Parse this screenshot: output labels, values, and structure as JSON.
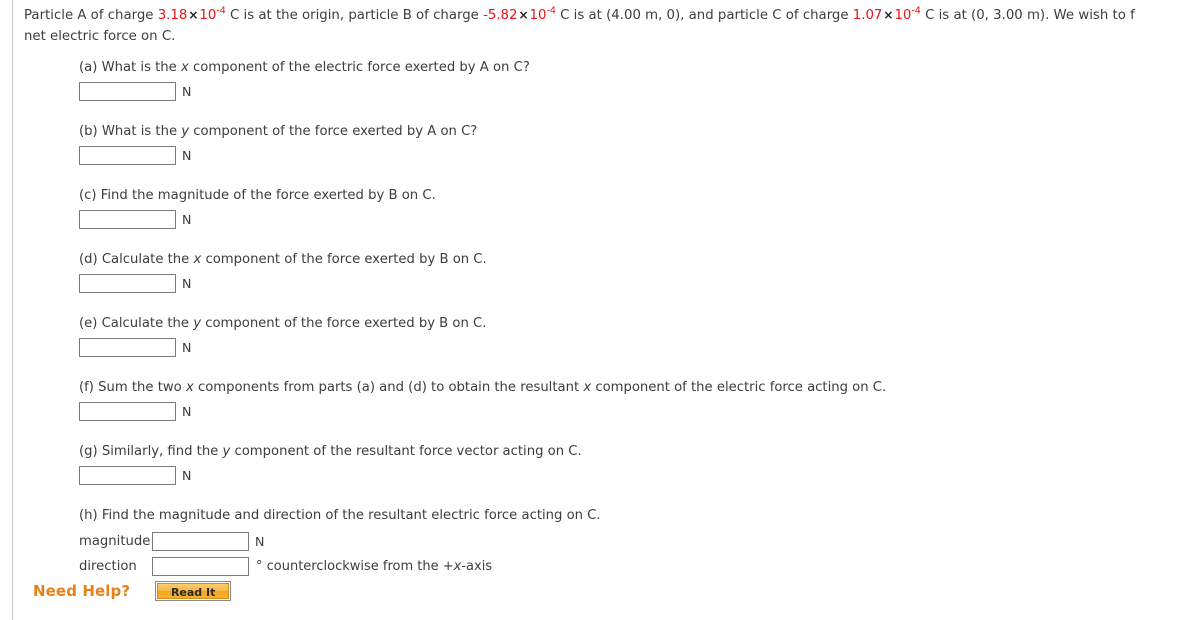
{
  "colors": {
    "value_red": "#ee1111",
    "accent_orange": "#e8801a",
    "text": "#3d3d3d",
    "rule": "#c9c9c9"
  },
  "stem": {
    "seg1": "Particle A of charge ",
    "q_a": "3.18",
    "times": "×",
    "pow_base": "10",
    "pow_exp_a": "-4",
    "seg2": " C is at the origin, particle B of charge ",
    "q_b": "-5.82",
    "pow_exp_b": "-4",
    "seg3": " C is at (4.00 m, 0), and particle C of charge ",
    "q_c": "1.07",
    "pow_exp_c": "-4",
    "seg4": " C is at (0, 3.00 m). We wish to f",
    "line2": "net electric force on C."
  },
  "parts": [
    {
      "name": "part-a",
      "pre": "(a) What is the ",
      "var": "x",
      "post": " component of the electric force exerted by A on C?",
      "value": "",
      "unit": "N"
    },
    {
      "name": "part-b",
      "pre": "(b) What is the ",
      "var": "y",
      "post": " component of the force exerted by A on C?",
      "value": "",
      "unit": "N"
    },
    {
      "name": "part-c",
      "pre": "(c) Find the magnitude of the force exerted by B on C.",
      "var": "",
      "post": "",
      "value": "",
      "unit": "N"
    },
    {
      "name": "part-d",
      "pre": "(d) Calculate the ",
      "var": "x",
      "post": " component of the force exerted by B on C.",
      "value": "",
      "unit": "N"
    },
    {
      "name": "part-e",
      "pre": "(e) Calculate the ",
      "var": "y",
      "post": " component of the force exerted by B on C.",
      "value": "",
      "unit": "N"
    },
    {
      "name": "part-f",
      "pre": "(f) Sum the two ",
      "var": "x",
      "post": " components from parts (a) and (d) to obtain the resultant ",
      "var2": "x",
      "post2": " component of the electric force acting on C.",
      "value": "",
      "unit": "N"
    },
    {
      "name": "part-g",
      "pre": "(g) Similarly, find the ",
      "var": "y",
      "post": " component of the resultant force vector acting on C.",
      "value": "",
      "unit": "N"
    }
  ],
  "part_h": {
    "question": "(h) Find the magnitude and direction of the resultant electric force acting on C.",
    "magnitude_label": "magnitude",
    "magnitude_value": "",
    "magnitude_unit": "N",
    "direction_label": "direction",
    "direction_value": "",
    "direction_unit_pre": "° counterclockwise from the +",
    "direction_unit_var": "x",
    "direction_unit_post": "-axis"
  },
  "need_help": {
    "label": "Need Help?",
    "read_it": "Read It"
  }
}
